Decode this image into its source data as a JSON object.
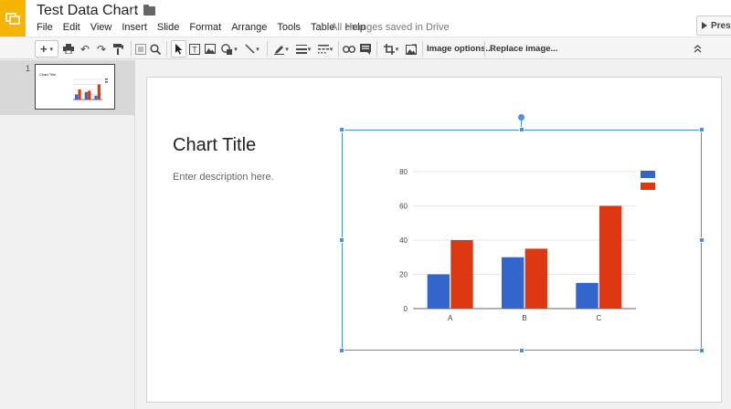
{
  "app": {
    "logo_icon": "slides-logo-icon",
    "accent": "#f4b400"
  },
  "header": {
    "title": "Test Data Chart",
    "save_status": "All changes saved in Drive",
    "present_label": "Pres"
  },
  "menu": [
    "File",
    "Edit",
    "View",
    "Insert",
    "Slide",
    "Format",
    "Arrange",
    "Tools",
    "Table",
    "Help"
  ],
  "toolbar": {
    "image_options_label": "Image options...",
    "replace_image_label": "Replace image..."
  },
  "sidebar": {
    "slide_number": "1"
  },
  "slide": {
    "title": "Chart Title",
    "description": "Enter description here."
  },
  "chart_data": {
    "type": "bar",
    "categories": [
      "A",
      "B",
      "C"
    ],
    "series": [
      {
        "values": [
          20,
          30,
          15
        ],
        "color": "#3366cc"
      },
      {
        "values": [
          40,
          35,
          60
        ],
        "color": "#dc3912"
      }
    ],
    "ylim": [
      0,
      80
    ],
    "yticks": [
      0,
      20,
      40,
      60,
      80
    ],
    "grid": true,
    "legend": "top-right"
  }
}
